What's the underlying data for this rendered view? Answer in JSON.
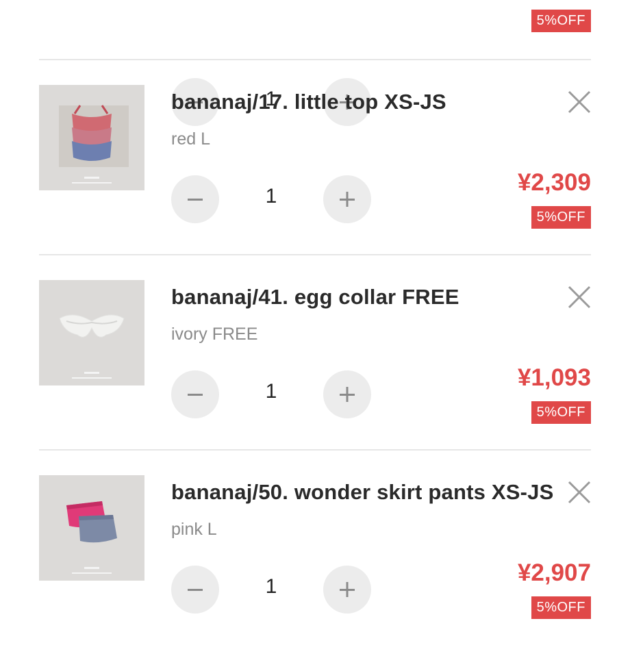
{
  "colors": {
    "accent": "#e04848",
    "divider": "#e6e6e6",
    "button_bg": "#ececec",
    "muted_text": "#8a8a8a"
  },
  "partial_item": {
    "quantity": "1",
    "discount_badge": "5%OFF"
  },
  "cart_items": [
    {
      "name": "bananaj/17. little top XS-JS",
      "variant": "red L",
      "quantity": "1",
      "price": "¥2,309",
      "discount_badge": "5%OFF",
      "image_icon": "gingham-tops-photo"
    },
    {
      "name": "bananaj/41. egg collar FREE",
      "variant": "ivory FREE",
      "quantity": "1",
      "price": "¥1,093",
      "discount_badge": "5%OFF",
      "image_icon": "lace-collar-photo"
    },
    {
      "name": "bananaj/50. wonder skirt pants XS-JS",
      "variant": "pink L",
      "quantity": "1",
      "price": "¥2,907",
      "discount_badge": "5%OFF",
      "image_icon": "skirt-pants-photo"
    }
  ],
  "icons": {
    "remove": "close-icon",
    "decrement": "minus-icon",
    "increment": "plus-icon"
  }
}
